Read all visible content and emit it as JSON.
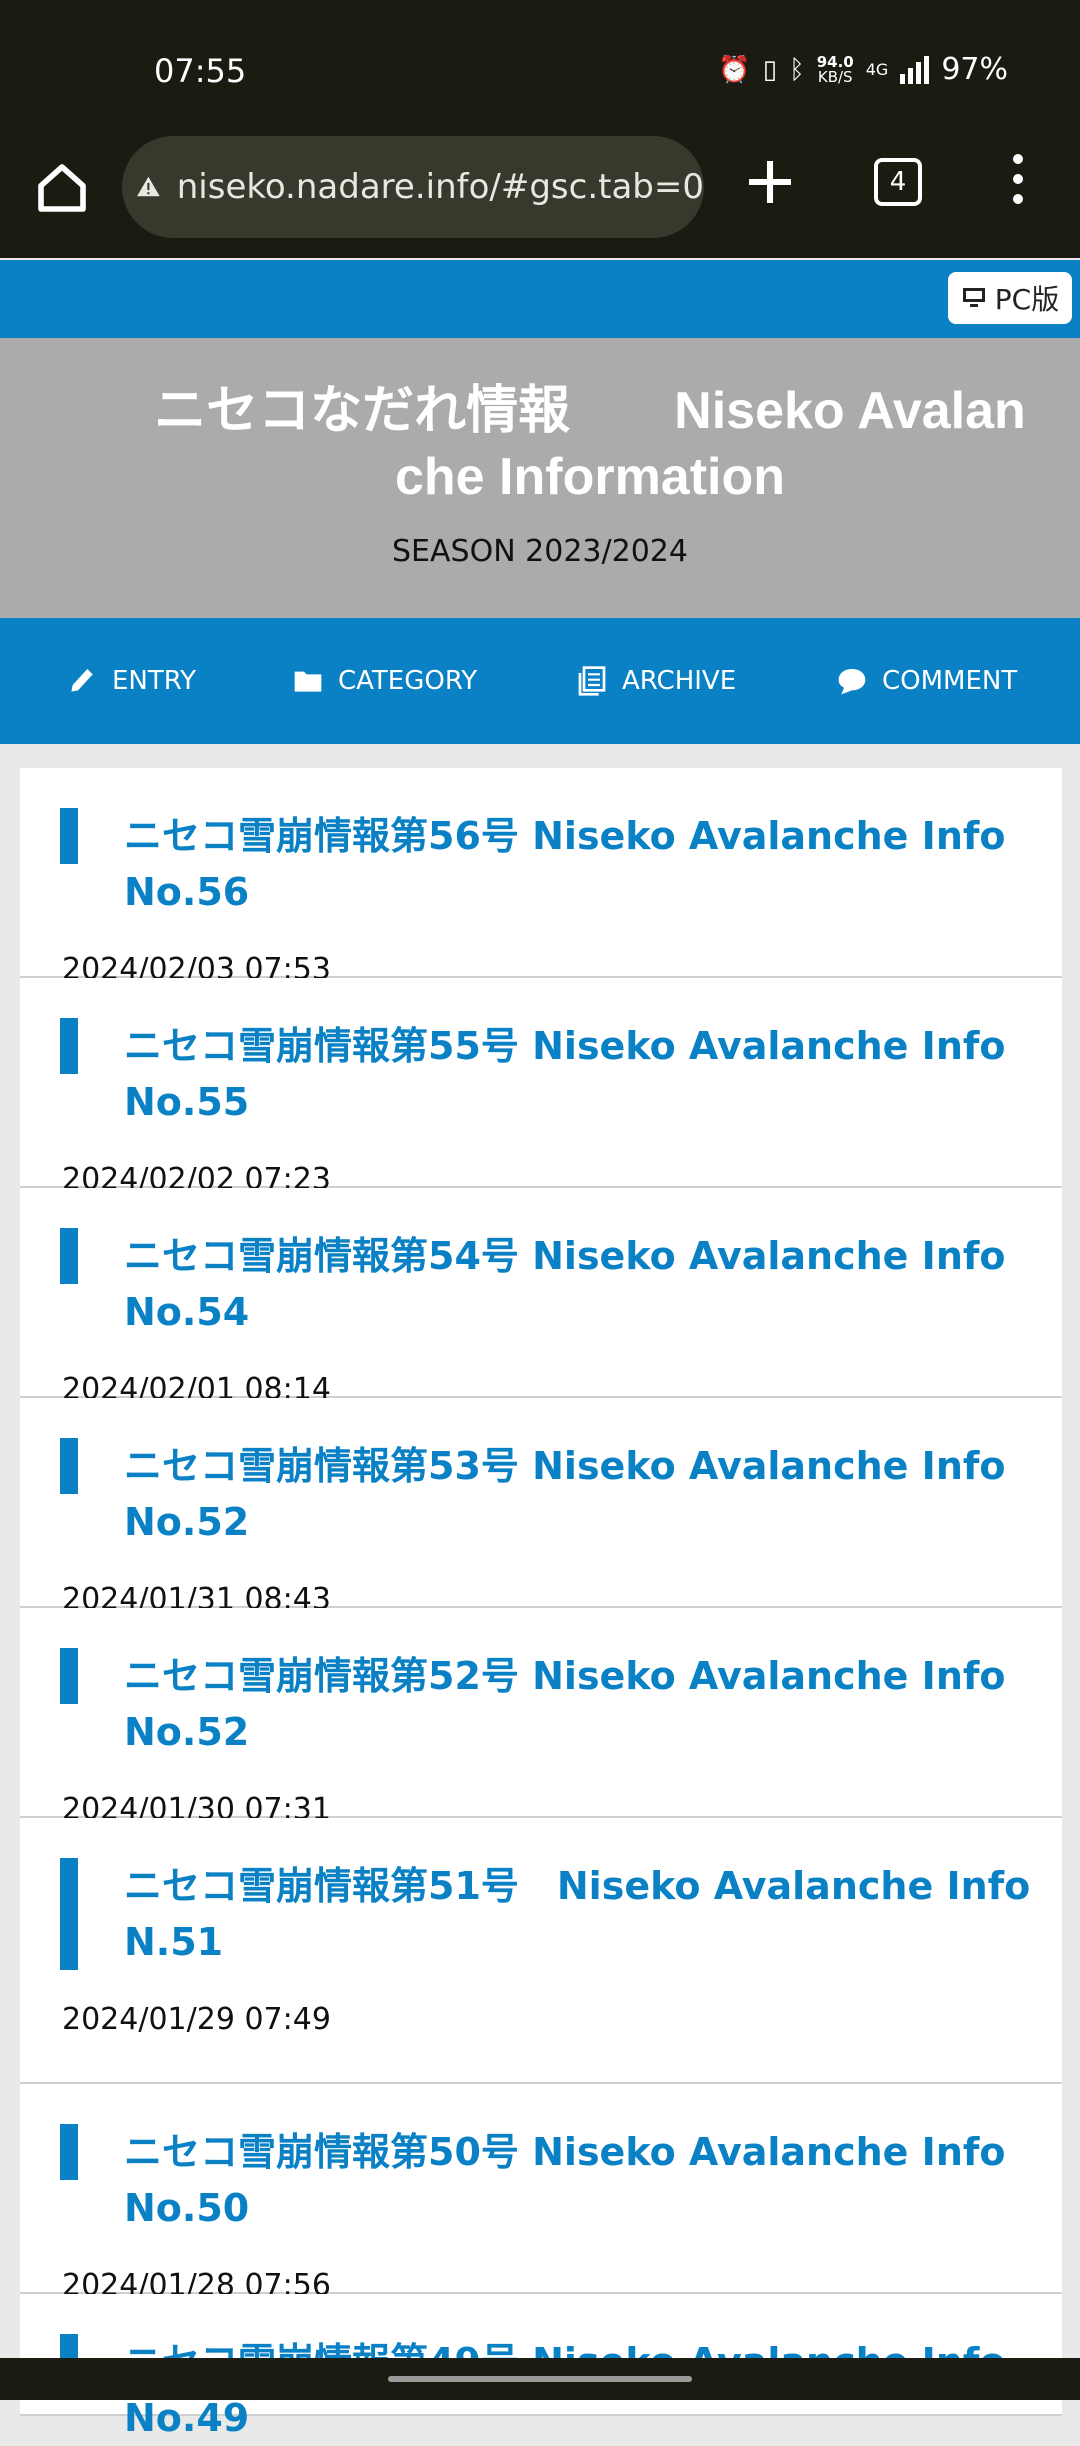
{
  "status_bar": {
    "time": "07:55",
    "net_speed_value": "94.0",
    "net_speed_unit": "KB/S",
    "network_type": "4G",
    "battery": "97%"
  },
  "browser": {
    "url": "niseko.nadare.info/#gsc.tab=0",
    "tab_count": "4"
  },
  "site": {
    "pc_button_label": "PC版",
    "title": "ニセコなだれ情報　　Niseko Avalanche Information",
    "season": "SEASON 2023/2024"
  },
  "nav": {
    "items": [
      {
        "label": "ENTRY",
        "icon": "pencil-icon"
      },
      {
        "label": "CATEGORY",
        "icon": "folder-icon"
      },
      {
        "label": "ARCHIVE",
        "icon": "archive-icon"
      },
      {
        "label": "COMMENT",
        "icon": "comment-icon"
      }
    ]
  },
  "entries": [
    {
      "title": "ニセコ雪崩情報第56号 Niseko Avalanche Info No.56",
      "date": "2024/02/03 07:53"
    },
    {
      "title": "ニセコ雪崩情報第55号 Niseko Avalanche Info No.55",
      "date": "2024/02/02 07:23"
    },
    {
      "title": "ニセコ雪崩情報第54号 Niseko Avalanche Info No.54",
      "date": "2024/02/01 08:14"
    },
    {
      "title": "ニセコ雪崩情報第53号 Niseko Avalanche Info No.52",
      "date": "2024/01/31 08:43"
    },
    {
      "title": "ニセコ雪崩情報第52号 Niseko Avalanche Info No.52",
      "date": "2024/01/30 07:31"
    },
    {
      "title": "ニセコ雪崩情報第51号　Niseko Avalanche Info N.51",
      "date": "2024/01/29 07:49"
    },
    {
      "title": "ニセコ雪崩情報第50号 Niseko Avalanche Info No.50",
      "date": "2024/01/28 07:56"
    },
    {
      "title": "ニセコ雪崩情報第49号 Niseko Avalanche Info No.49",
      "date": ""
    }
  ]
}
